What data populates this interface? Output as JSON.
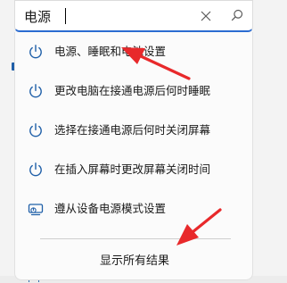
{
  "search": {
    "value": "电源",
    "clear_icon": "close-icon",
    "search_icon": "search-icon"
  },
  "results": [
    {
      "label": "电源、睡眠和电池设置",
      "icon": "power-icon"
    },
    {
      "label": "更改电脑在接通电源后何时睡眠",
      "icon": "power-icon"
    },
    {
      "label": "选择在接通电源后何时关闭屏幕",
      "icon": "power-icon"
    },
    {
      "label": "在插入屏幕时更改屏幕关闭时间",
      "icon": "power-icon"
    },
    {
      "label": "遵从设备电源模式设置",
      "icon": "device-power-mode-icon"
    }
  ],
  "footer": {
    "show_all_label": "显示所有结果"
  },
  "colors": {
    "accent": "#2b6cd1",
    "power_icon": "#1f5fa8",
    "annotation_arrow": "#e8292b"
  }
}
